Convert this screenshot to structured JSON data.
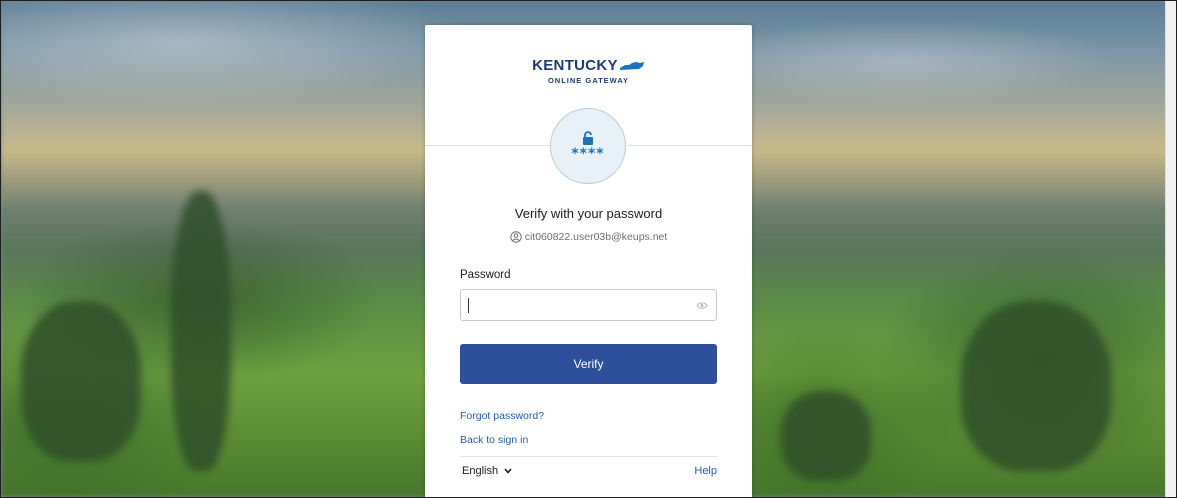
{
  "brand": {
    "line1": "KENTUCKY",
    "line2": "ONLINE GATEWAY",
    "color": "#1e3a78",
    "accent": "#1d73b8"
  },
  "badge": {
    "icon": "unlocked-padlock-icon",
    "masked_text": "****"
  },
  "auth": {
    "title": "Verify with your password",
    "identifier": "cit060822.user03b@keups.net",
    "identifier_icon": "user-circle-icon"
  },
  "form": {
    "password_label": "Password",
    "password_value": "",
    "toggle_icon": "eye-icon",
    "submit_label": "Verify",
    "submit_color": "#2e4f9c"
  },
  "links": {
    "forgot_password": "Forgot password?",
    "back_to_sign_in": "Back to sign in"
  },
  "footer": {
    "language": "English",
    "language_icon": "chevron-down-icon",
    "help": "Help"
  }
}
